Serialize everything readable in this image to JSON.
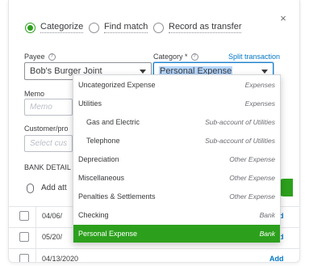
{
  "modal": {
    "close_glyph": "×"
  },
  "match_options": [
    {
      "label": "Categorize",
      "selected": true
    },
    {
      "label": "Find match",
      "selected": false
    },
    {
      "label": "Record as transfer",
      "selected": false
    }
  ],
  "payee": {
    "label": "Payee",
    "value": "Bob's Burger Joint"
  },
  "category": {
    "label": "Category *",
    "split_link": "Split transaction",
    "value": "Personal Expense"
  },
  "memo": {
    "label": "Memo",
    "placeholder": "Memo"
  },
  "customer": {
    "label": "Customer/pro",
    "placeholder": "Select cus"
  },
  "bank_detail": {
    "label": "BANK DETAIL"
  },
  "attachment": {
    "link": "Add att"
  },
  "category_options": [
    {
      "name": "Uncategorized Expense",
      "type": "Expenses",
      "sub": false,
      "active": false
    },
    {
      "name": "Utilities",
      "type": "Expenses",
      "sub": false,
      "active": false
    },
    {
      "name": "Gas and Electric",
      "type": "Sub-account of Utilities",
      "sub": true,
      "active": false
    },
    {
      "name": "Telephone",
      "type": "Sub-account of Utilities",
      "sub": true,
      "active": false
    },
    {
      "name": "Depreciation",
      "type": "Other Expense",
      "sub": false,
      "active": false
    },
    {
      "name": "Miscellaneous",
      "type": "Other Expense",
      "sub": false,
      "active": false
    },
    {
      "name": "Penalties & Settlements",
      "type": "Other Expense",
      "sub": false,
      "active": false
    },
    {
      "name": "Checking",
      "type": "Bank",
      "sub": false,
      "active": false
    },
    {
      "name": "Personal Expense",
      "type": "Bank",
      "sub": false,
      "active": true
    }
  ],
  "transactions": [
    {
      "date": "04/06/",
      "action": "Add"
    },
    {
      "date": "05/20/",
      "action": "Add"
    },
    {
      "date": "04/13/2020",
      "action": "Add"
    }
  ],
  "colors": {
    "accent_green": "#2ca01c",
    "link_blue": "#0077c5",
    "focus_blue": "#1c82cb"
  }
}
